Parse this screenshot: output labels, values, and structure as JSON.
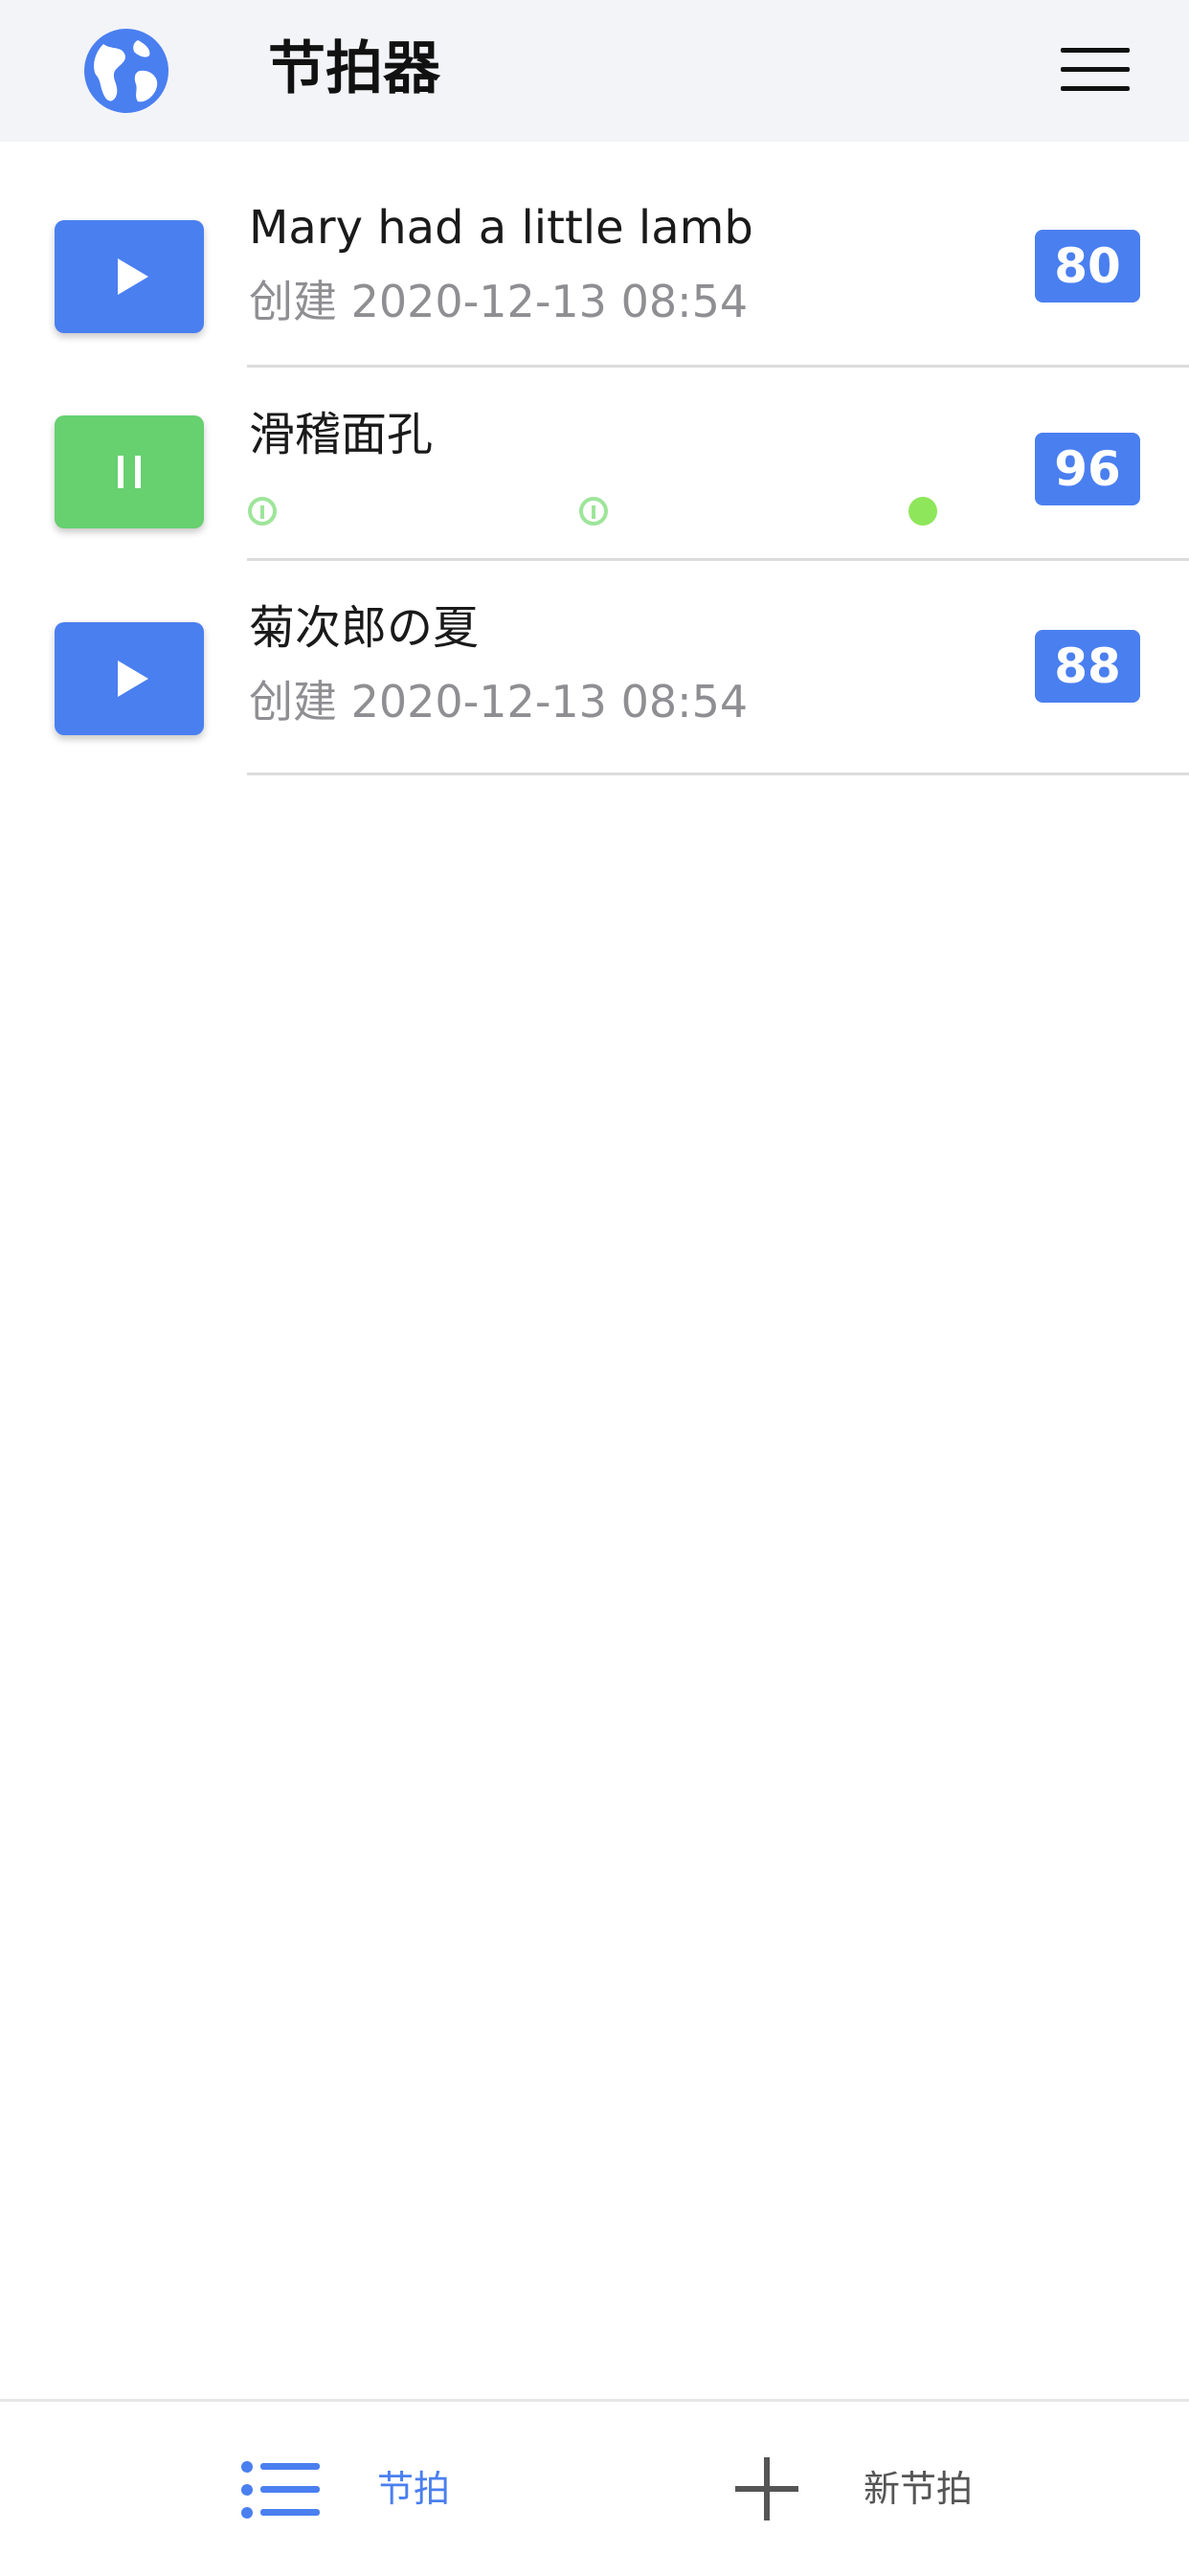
{
  "header": {
    "title": "节拍器",
    "left_icon": "globe-icon",
    "right_icon": "hamburger-menu-icon"
  },
  "metronomes": [
    {
      "title": "Mary had a little lamb",
      "subtitle": "创建 2020-12-13 08:54",
      "bpm": "80",
      "state": "stopped",
      "button_icon": "play-icon"
    },
    {
      "title": "滑稽面孔",
      "bpm": "96",
      "state": "playing",
      "button_icon": "pause-icon",
      "beats": [
        "inactive",
        "inactive",
        "active"
      ]
    },
    {
      "title": "菊次郎の夏",
      "subtitle": "创建 2020-12-13 08:54",
      "bpm": "88",
      "state": "stopped",
      "button_icon": "play-icon"
    }
  ],
  "tabbar": {
    "tabs": [
      {
        "label": "节拍",
        "icon": "list-icon",
        "active": true
      },
      {
        "label": "新节拍",
        "icon": "plus-icon",
        "active": false
      }
    ]
  },
  "colors": {
    "accent_blue": "#4a7ff0",
    "playing_green": "#67d06f",
    "beat_active": "#8ee65a",
    "beat_inactive": "#9ee59a",
    "subtitle_gray": "#8f8f93",
    "header_bg": "#f3f4f7"
  }
}
